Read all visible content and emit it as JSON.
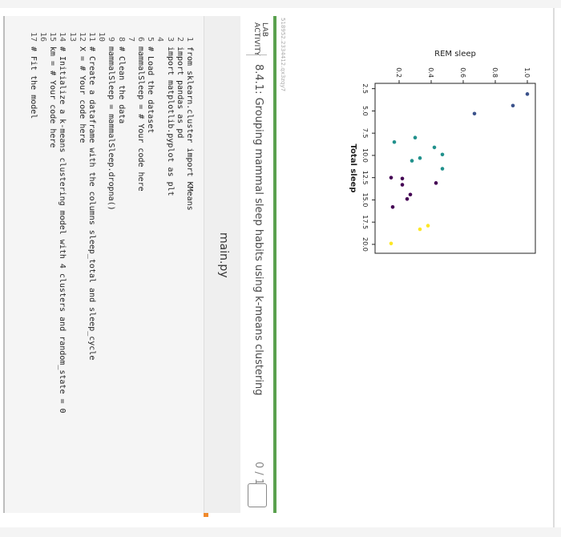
{
  "lab": {
    "id": "518952.2334412.qx3zqy7",
    "label": "LAB ACTIVITY",
    "title": "8.4.1: Grouping mammal sleep habits using k-means clustering",
    "score": "0 / 1"
  },
  "editor": {
    "file_name": "main.py",
    "lines": [
      {
        "num": "1",
        "text": "from sklearn.cluster import KMeans"
      },
      {
        "num": "2",
        "text": "import pandas as pd"
      },
      {
        "num": "3",
        "text": "import matplotlib.pyplot as plt"
      },
      {
        "num": "4",
        "text": ""
      },
      {
        "num": "5",
        "text": "# Load the dataset"
      },
      {
        "num": "6",
        "text": "mammalSleep = # Your code here"
      },
      {
        "num": "7",
        "text": ""
      },
      {
        "num": "8",
        "text": "# Clean the data"
      },
      {
        "num": "9",
        "text": "mammalSleep = mammalSleep.dropna()"
      },
      {
        "num": "10",
        "text": ""
      },
      {
        "num": "11",
        "text": "# Create a dataframe with the columns sleep_total and sleep_cycle"
      },
      {
        "num": "12",
        "text": "X = # Your code here"
      },
      {
        "num": "13",
        "text": ""
      },
      {
        "num": "14",
        "text": "# Initialize a k-means clustering model with 4 clusters and random_state = 0"
      },
      {
        "num": "15",
        "text": "km = # Your code here"
      },
      {
        "num": "16",
        "text": ""
      },
      {
        "num": "17",
        "text": "# Fit the model"
      }
    ]
  },
  "chart_data": {
    "type": "scatter",
    "title": "",
    "xlabel": "Total sleep",
    "ylabel": "REM sleep",
    "xlim": [
      1.9,
      21.0
    ],
    "ylim": [
      0.05,
      1.05
    ],
    "xticks": [
      "2.5",
      "5.0",
      "7.5",
      "10.0",
      "12.5",
      "15.0",
      "17.5",
      "20.0"
    ],
    "yticks": [
      "0.2",
      "0.4",
      "0.6",
      "0.8",
      "1.0"
    ],
    "grid": false,
    "series": [
      {
        "color": "#3b528b",
        "points": [
          [
            3.1,
            1.0
          ],
          [
            4.4,
            0.91
          ],
          [
            5.3,
            0.67
          ]
        ]
      },
      {
        "color": "#21918c",
        "points": [
          [
            8.0,
            0.3
          ],
          [
            8.5,
            0.17
          ],
          [
            9.1,
            0.42
          ],
          [
            9.9,
            0.47
          ],
          [
            10.3,
            0.33
          ],
          [
            10.6,
            0.28
          ],
          [
            11.5,
            0.47
          ]
        ]
      },
      {
        "color": "#440154",
        "points": [
          [
            12.5,
            0.15
          ],
          [
            12.6,
            0.22
          ],
          [
            13.1,
            0.43
          ],
          [
            13.3,
            0.22
          ],
          [
            14.4,
            0.27
          ],
          [
            14.9,
            0.25
          ],
          [
            15.8,
            0.16
          ]
        ]
      },
      {
        "color": "#fde725",
        "points": [
          [
            17.9,
            0.38
          ],
          [
            18.3,
            0.33
          ],
          [
            19.9,
            0.15
          ]
        ]
      }
    ]
  }
}
